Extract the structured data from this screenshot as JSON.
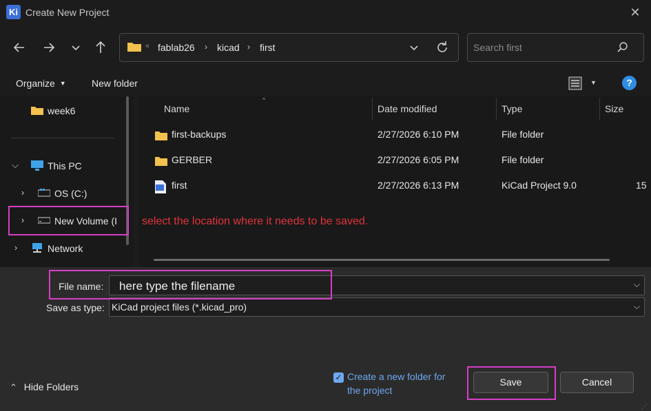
{
  "window": {
    "app_icon_text": "Ki",
    "title": "Create New Project"
  },
  "address": {
    "crumbs": [
      "fablab26",
      "kicad",
      "first"
    ],
    "overflow_marker": "«"
  },
  "search": {
    "placeholder": "Search first"
  },
  "toolbar": {
    "organize_label": "Organize",
    "new_folder_label": "New folder"
  },
  "nav": {
    "items": [
      {
        "label": "week6"
      },
      {
        "label": "This PC"
      },
      {
        "label": "OS (C:)"
      },
      {
        "label": "New Volume (I"
      },
      {
        "label": "Network"
      }
    ]
  },
  "columns": {
    "name": "Name",
    "date": "Date modified",
    "type": "Type",
    "size": "Size"
  },
  "files": [
    {
      "name": "first-backups",
      "date": "2/27/2026 6:10 PM",
      "type": "File folder",
      "size": "",
      "icon": "folder-icon"
    },
    {
      "name": "GERBER",
      "date": "2/27/2026 6:05 PM",
      "type": "File folder",
      "size": "",
      "icon": "folder-icon"
    },
    {
      "name": "first",
      "date": "2/27/2026 6:13 PM",
      "type": "KiCad Project 9.0",
      "size": "15",
      "icon": "kicad-project-icon"
    }
  ],
  "annotation": "select the location where it needs to be saved.",
  "form": {
    "filename_label": "File name:",
    "filename_value": "here type the filename",
    "savetype_label": "Save as type:",
    "savetype_value": "KiCad project files (*.kicad_pro)"
  },
  "footer": {
    "hide_folders_label": "Hide Folders",
    "checkbox_label_line1": "Create a new folder for",
    "checkbox_label_line2": "the project",
    "checkbox_checked": true,
    "save_label": "Save",
    "cancel_label": "Cancel"
  },
  "colors": {
    "highlight": "#d63fc6",
    "annotation": "#e0343c",
    "link": "#6fa8ef",
    "help": "#2f8de4"
  }
}
